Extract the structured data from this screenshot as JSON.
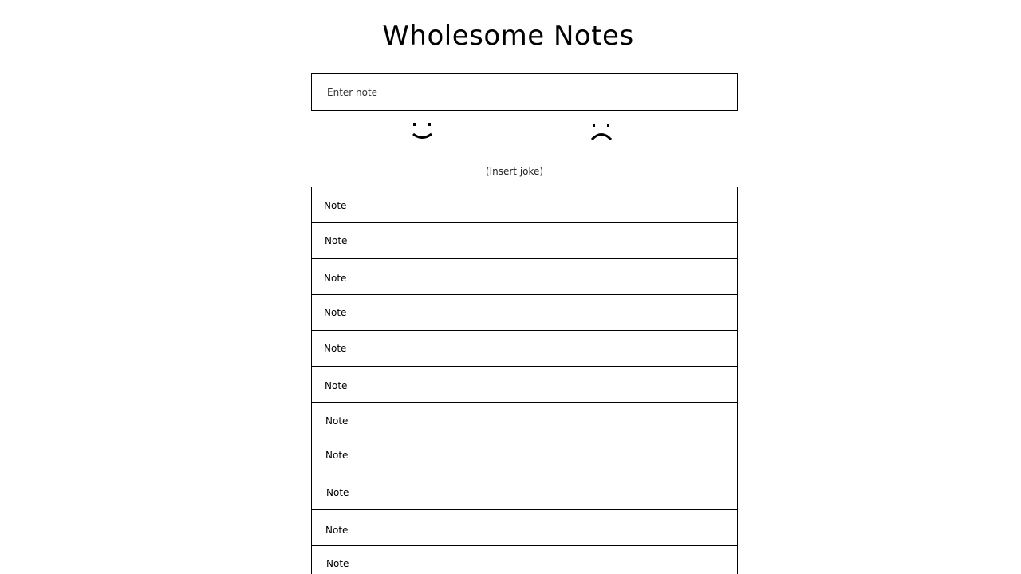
{
  "header": {
    "title": "Wholesome Notes"
  },
  "input": {
    "placeholder": "Enter note",
    "value": ""
  },
  "faces": {
    "happy_icon": "smiley-face-icon",
    "sad_icon": "frowny-face-icon"
  },
  "joke": {
    "text": "(Insert joke)"
  },
  "notes": [
    {
      "text": "Note"
    },
    {
      "text": "Note"
    },
    {
      "text": "Note"
    },
    {
      "text": "Note"
    },
    {
      "text": "Note"
    },
    {
      "text": "Note"
    },
    {
      "text": "Note"
    },
    {
      "text": "Note"
    },
    {
      "text": "Note"
    },
    {
      "text": "Note"
    },
    {
      "text": "Note"
    }
  ]
}
